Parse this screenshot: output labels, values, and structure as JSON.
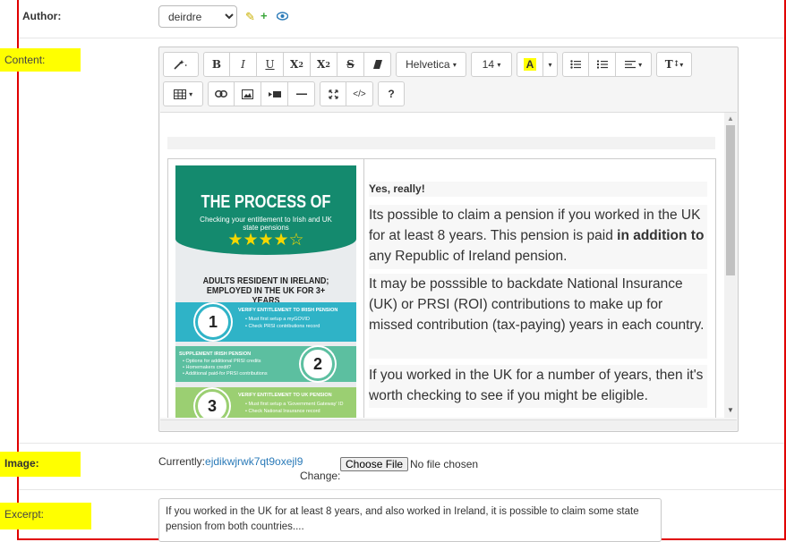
{
  "author": {
    "label": "Author:",
    "selected": "deirdre"
  },
  "content": {
    "label": "Content:",
    "toolbar": {
      "font_name": "Helvetica",
      "font_size": "14",
      "color_letter": "A",
      "help_label": "?"
    },
    "infographic": {
      "title": "THE PROCESS OF",
      "subtitle": "Checking your entitlement to Irish and UK state pensions",
      "stars": "★★★★☆",
      "section": "ADULTS RESIDENT IN IRELAND; EMPLOYED IN THE UK FOR 3+ YEARS",
      "steps": [
        {
          "num": "1",
          "title": "VERIFY ENTITLEMENT TO IRISH PENSION",
          "items": [
            "Must first setup a myGOVID",
            "Check PRSI contributions record"
          ]
        },
        {
          "num": "2",
          "title": "SUPPLEMENT IRISH PENSION",
          "items": [
            "Options for additional PRSI credits",
            "Homemakers credit?",
            "Additional paid-for PRSI contributions"
          ]
        },
        {
          "num": "3",
          "title": "VERIFY ENTITLEMENT TO UK PENSION",
          "items": [
            "Must first setup a 'Government Gateway' ID",
            "Check National Insurance record"
          ]
        }
      ]
    },
    "heading": "Yes, really!",
    "para1_a": "Its possible to claim a pension if you worked in the UK for at least 8 years. This pension is paid ",
    "para1_b": "in addition to",
    "para1_c": " any Republic of Ireland pension.",
    "para2": "It may be posssible to backdate National Insurance (UK) or PRSI (ROI) contributions to make up for missed contribution (tax-paying) years in each country.",
    "para3": "If you worked in the UK for a number of years, then it's worth checking to see if you might be eligible."
  },
  "image": {
    "label": "Image:",
    "currently_label": "Currently:",
    "current_file": "ejdikwjrwk7qt9oxejl9",
    "change_label": "Change:",
    "choose_button": "Choose File",
    "no_file": "No file chosen"
  },
  "excerpt": {
    "label": "Excerpt:",
    "value": "If you worked in the UK for at least 8 years, and also worked in Ireland, it is possible to claim some state pension from both countries...."
  },
  "colors": {
    "highlight": "#ffff00",
    "frame": "#e00000",
    "link": "#2a7ab8",
    "infographic_green": "#148a6e"
  },
  "icons": [
    "pencil-icon",
    "plus-icon",
    "eye-icon",
    "magic-icon",
    "bold-icon",
    "italic-icon",
    "underline-icon",
    "superscript-icon",
    "subscript-icon",
    "strikethrough-icon",
    "eraser-icon",
    "unordered-list-icon",
    "ordered-list-icon",
    "align-icon",
    "line-height-icon",
    "table-icon",
    "link-icon",
    "picture-icon",
    "video-icon",
    "horizontal-rule-icon",
    "fullscreen-icon",
    "code-view-icon",
    "help-icon"
  ]
}
